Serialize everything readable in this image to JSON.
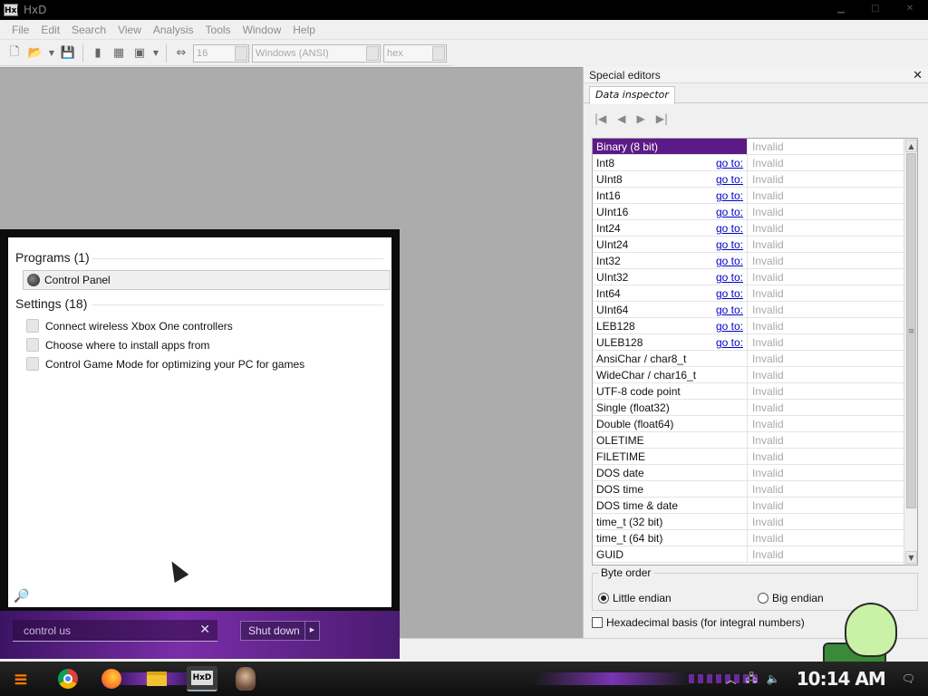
{
  "window": {
    "title": "HxD"
  },
  "menu": [
    "File",
    "Edit",
    "Search",
    "View",
    "Analysis",
    "Tools",
    "Window",
    "Help"
  ],
  "toolbar": {
    "bytes_per_row": "16",
    "charset": "Windows (ANSI)",
    "offset_base": "hex"
  },
  "panel": {
    "title": "Special editors",
    "close_glyph": "✕",
    "tab": "Data inspector",
    "nav": [
      "|◀",
      "◀",
      "▶",
      "▶|"
    ],
    "goto_label": "go to:",
    "rows": [
      {
        "name": "Binary (8 bit)",
        "value": "Invalid",
        "goto": false,
        "selected": true
      },
      {
        "name": "Int8",
        "value": "Invalid",
        "goto": true
      },
      {
        "name": "UInt8",
        "value": "Invalid",
        "goto": true
      },
      {
        "name": "Int16",
        "value": "Invalid",
        "goto": true
      },
      {
        "name": "UInt16",
        "value": "Invalid",
        "goto": true
      },
      {
        "name": "Int24",
        "value": "Invalid",
        "goto": true
      },
      {
        "name": "UInt24",
        "value": "Invalid",
        "goto": true
      },
      {
        "name": "Int32",
        "value": "Invalid",
        "goto": true
      },
      {
        "name": "UInt32",
        "value": "Invalid",
        "goto": true
      },
      {
        "name": "Int64",
        "value": "Invalid",
        "goto": true
      },
      {
        "name": "UInt64",
        "value": "Invalid",
        "goto": true
      },
      {
        "name": "LEB128",
        "value": "Invalid",
        "goto": true
      },
      {
        "name": "ULEB128",
        "value": "Invalid",
        "goto": true
      },
      {
        "name": "AnsiChar / char8_t",
        "value": "Invalid",
        "goto": false
      },
      {
        "name": "WideChar / char16_t",
        "value": "Invalid",
        "goto": false
      },
      {
        "name": "UTF-8 code point",
        "value": "Invalid",
        "goto": false
      },
      {
        "name": "Single (float32)",
        "value": "Invalid",
        "goto": false
      },
      {
        "name": "Double (float64)",
        "value": "Invalid",
        "goto": false
      },
      {
        "name": "OLETIME",
        "value": "Invalid",
        "goto": false
      },
      {
        "name": "FILETIME",
        "value": "Invalid",
        "goto": false
      },
      {
        "name": "DOS date",
        "value": "Invalid",
        "goto": false
      },
      {
        "name": "DOS time",
        "value": "Invalid",
        "goto": false
      },
      {
        "name": "DOS time & date",
        "value": "Invalid",
        "goto": false
      },
      {
        "name": "time_t (32 bit)",
        "value": "Invalid",
        "goto": false
      },
      {
        "name": "time_t (64 bit)",
        "value": "Invalid",
        "goto": false
      },
      {
        "name": "GUID",
        "value": "Invalid",
        "goto": false
      }
    ],
    "byte_order": {
      "legend": "Byte order",
      "little": "Little endian",
      "big": "Big endian",
      "selected": "little"
    },
    "hex_basis": "Hexadecimal basis (for integral numbers)"
  },
  "start_menu": {
    "programs_heading": "Programs (1)",
    "program": "Control Panel",
    "settings_heading": "Settings (18)",
    "settings": [
      "Connect wireless Xbox One controllers",
      "Choose where to install apps from",
      "Control Game Mode for optimizing your PC for games"
    ],
    "search_value": "control us",
    "clear_glyph": "✕",
    "shutdown_label": "Shut down",
    "shutdown_more": "▶"
  },
  "taskbar": {
    "clock": "10:14 AM",
    "start_glyph": "≡"
  },
  "colors": {
    "selection": "#5b1a86",
    "accent_purple": "#7a2ea8",
    "link": "#0000cc"
  }
}
